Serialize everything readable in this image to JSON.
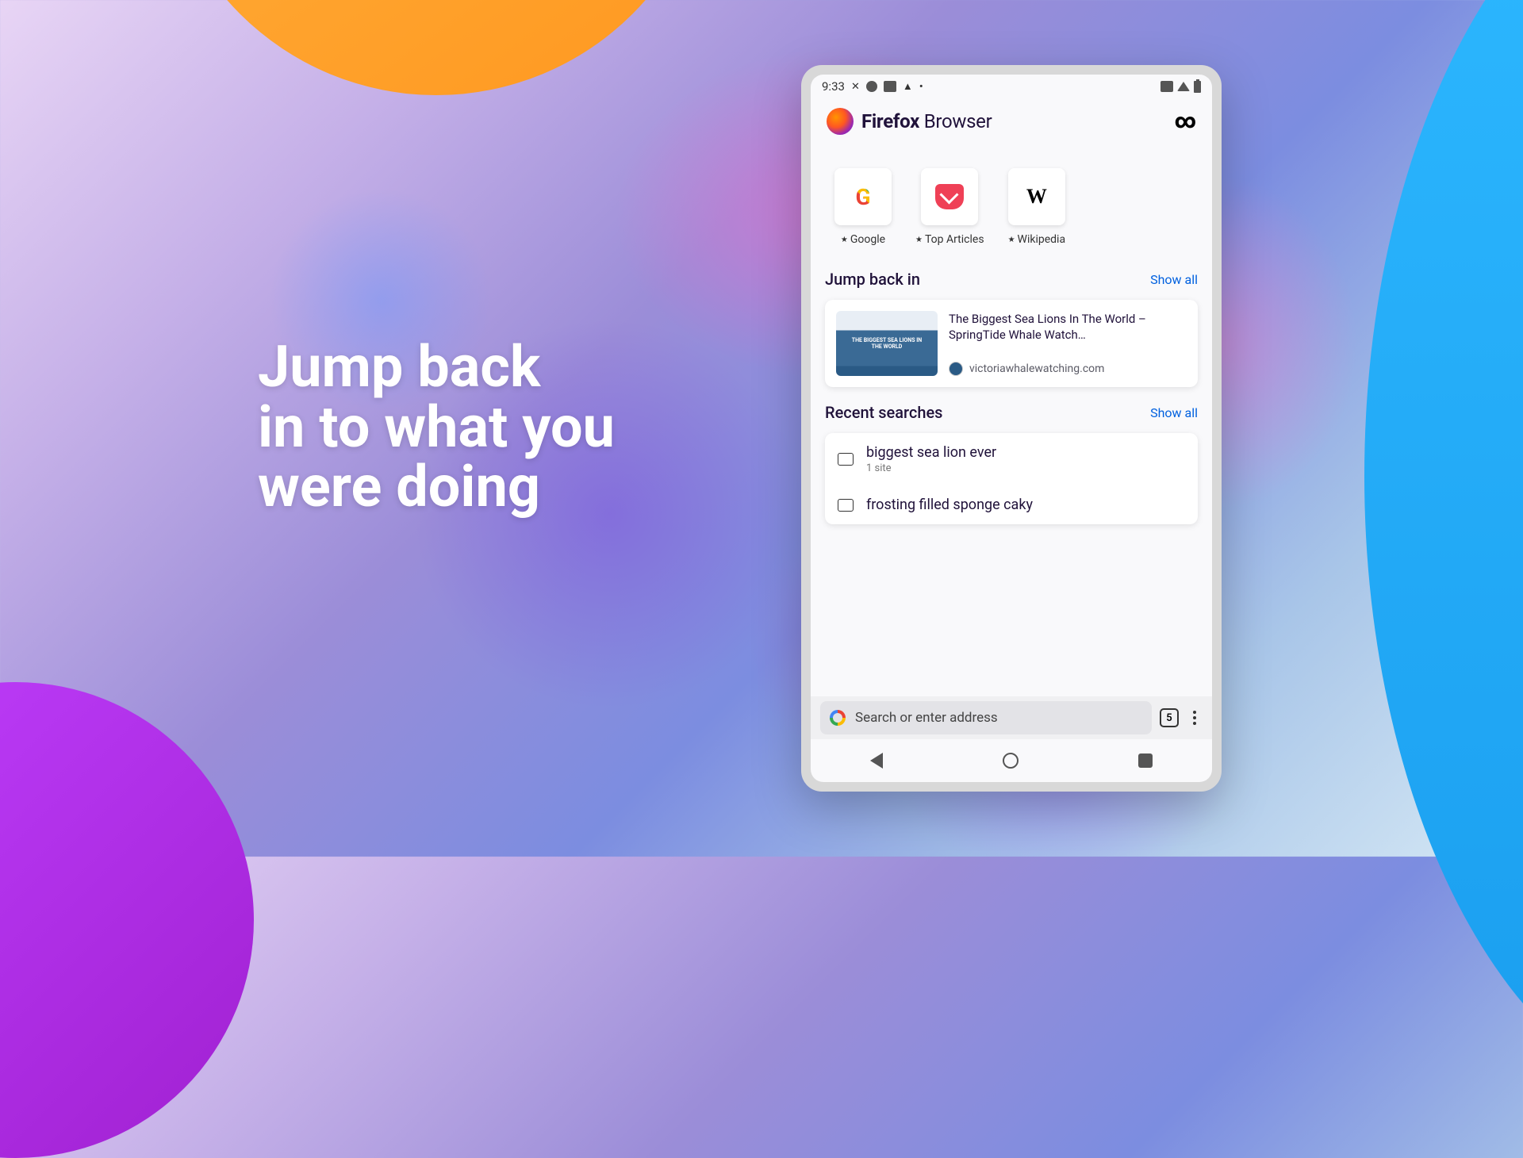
{
  "headline": "Jump back\nin to what you\nwere doing",
  "status": {
    "time": "9:33"
  },
  "brand": {
    "name_bold": "Firefox",
    "name_light": " Browser"
  },
  "topsites": [
    {
      "label": "Google",
      "icon": "google"
    },
    {
      "label": "Top Articles",
      "icon": "pocket"
    },
    {
      "label": "Wikipedia",
      "icon": "wikipedia"
    }
  ],
  "jumpback": {
    "title": "Jump back in",
    "show_all": "Show all",
    "card": {
      "title": "The Biggest Sea Lions In The World – SpringTide Whale Watch…",
      "source": "victoriawhalewatching.com",
      "thumb_text": "THE BIGGEST SEA LIONS IN\nTHE WORLD"
    }
  },
  "recent": {
    "title": "Recent searches",
    "show_all": "Show all",
    "items": [
      {
        "query": "biggest sea lion ever",
        "sub": "1 site"
      },
      {
        "query": "frosting filled sponge caky",
        "sub": ""
      }
    ]
  },
  "bottom": {
    "placeholder": "Search or enter address",
    "tab_count": "5"
  }
}
